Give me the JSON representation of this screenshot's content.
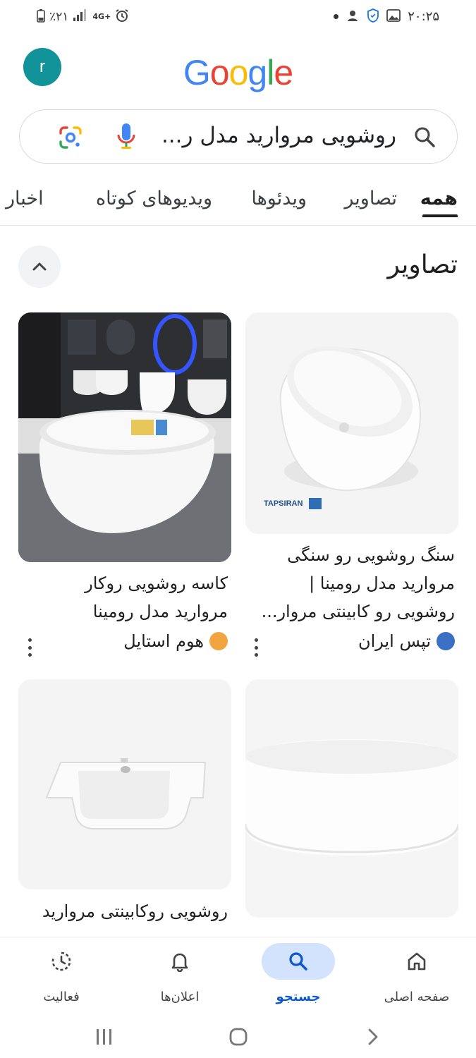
{
  "status_bar": {
    "battery": "٪۲۱",
    "time": "۲۰:۲۵",
    "network": "4G+"
  },
  "header": {
    "avatar_letter": "r",
    "logo_letters": [
      "G",
      "o",
      "o",
      "g",
      "l",
      "e"
    ],
    "logo_colors": [
      "#4285F4",
      "#EA4335",
      "#FBBC05",
      "#4285F4",
      "#34A853",
      "#EA4335"
    ]
  },
  "search": {
    "query": "روشویی مروارید مدل ر..."
  },
  "tabs": [
    {
      "label": "همه",
      "active": true
    },
    {
      "label": "تصاویر",
      "active": false
    },
    {
      "label": "ویدئوها",
      "active": false
    },
    {
      "label": "ویدیوهای کوتاه",
      "active": false
    },
    {
      "label": "اخبار",
      "active": false
    }
  ],
  "images_section": {
    "title": "تصاویر",
    "cards": [
      {
        "title_lines": [
          "سنگ روشویی رو سنگی",
          "مروارید مدل رومینا |",
          "روشویی رو کابینتی مروار..."
        ],
        "source": "تپس ایران",
        "watermark": "TAPSIRAN"
      },
      {
        "title_lines": [
          "کاسه روشویی روکار",
          "مروارید مدل رومینا"
        ],
        "source": "هوم استایل"
      },
      {
        "title_lines": [],
        "source": ""
      },
      {
        "title_lines": [
          "روشویی روکابینتی مروارید"
        ],
        "source": ""
      }
    ]
  },
  "bottom_nav": [
    {
      "label": "صفحه اصلی",
      "icon": "home-icon",
      "active": false
    },
    {
      "label": "جستجو",
      "icon": "search-icon",
      "active": true
    },
    {
      "label": "اعلان‌ها",
      "icon": "bell-icon",
      "active": false
    },
    {
      "label": "فعالیت",
      "icon": "activity-icon",
      "active": false
    }
  ],
  "colors": {
    "accent": "#0b57d0",
    "active_pill": "#d3e3fd",
    "avatar_bg": "#12939a"
  }
}
